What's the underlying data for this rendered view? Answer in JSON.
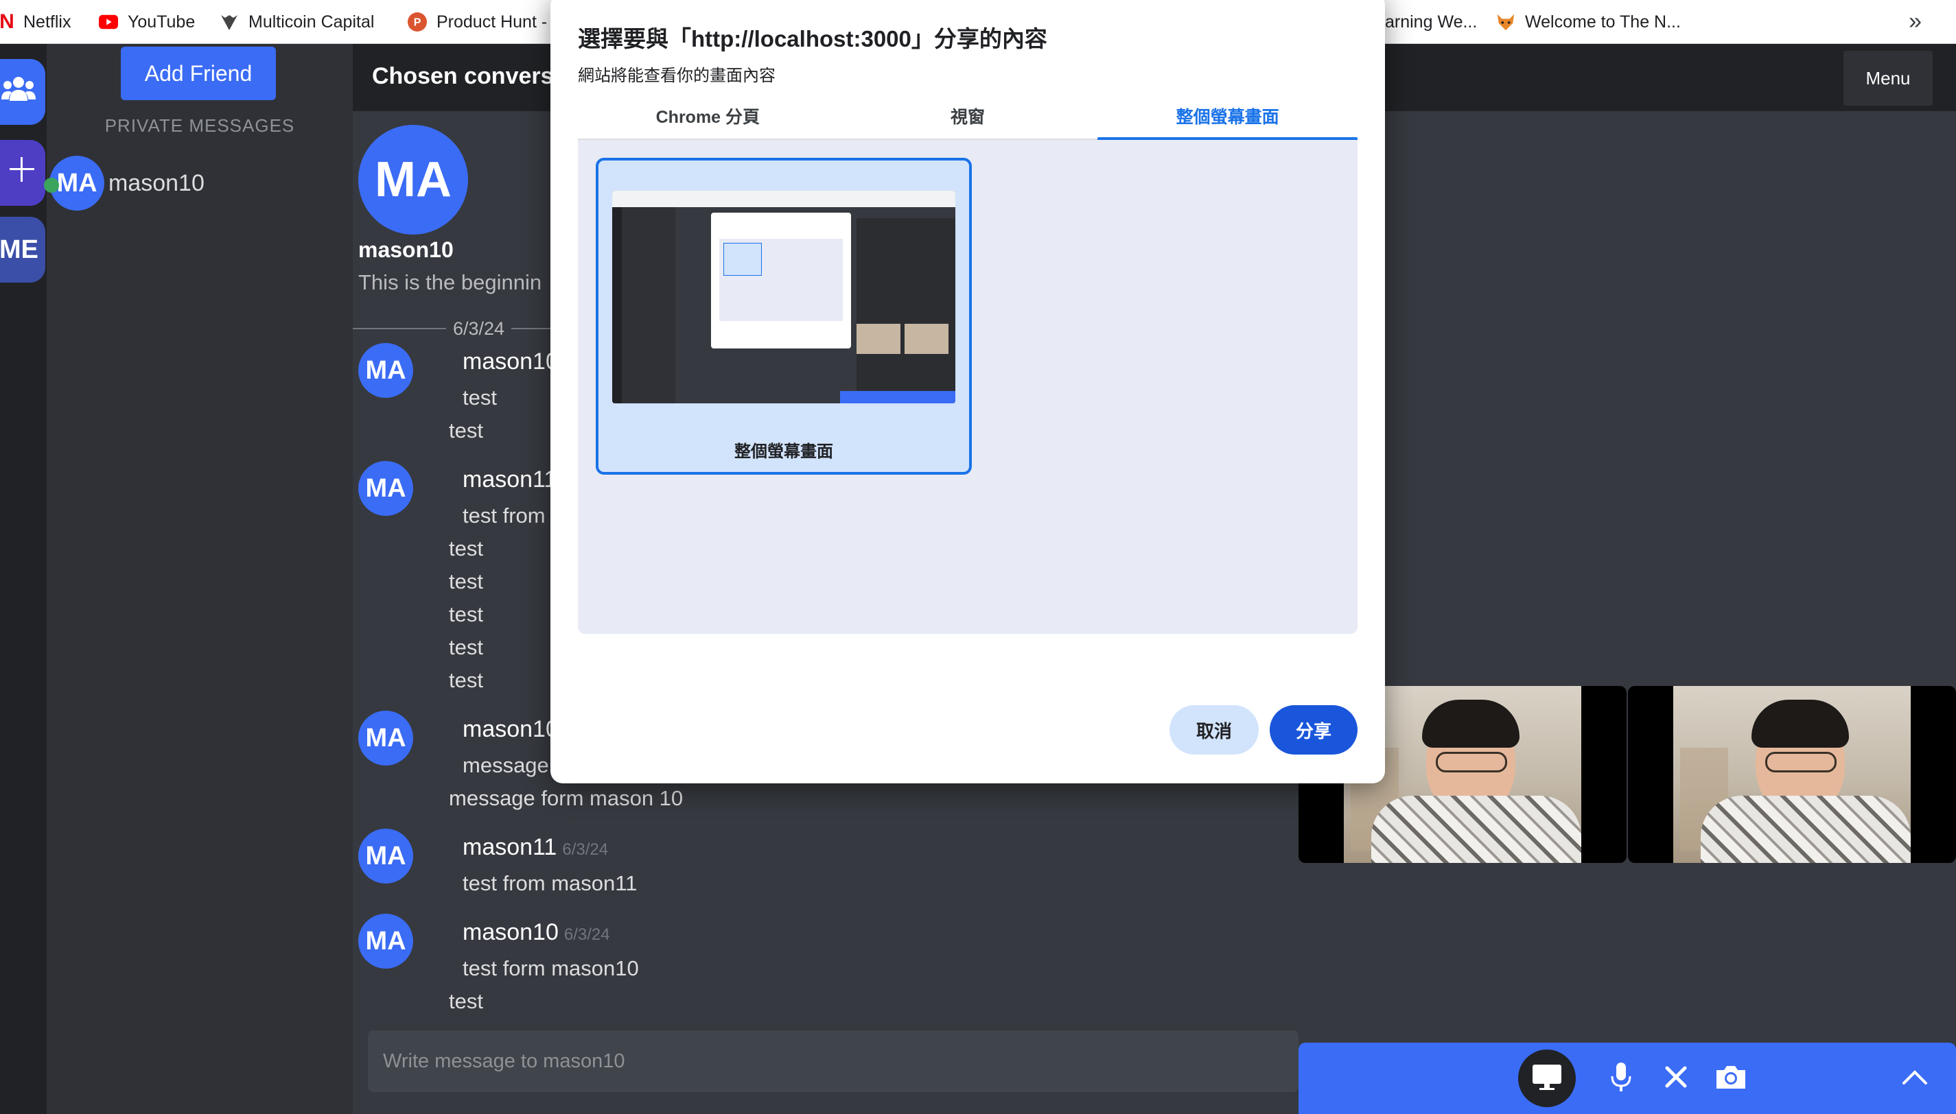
{
  "bookmarks": [
    {
      "label": "Netflix",
      "icon": "netflix-icon",
      "color": "#e50914"
    },
    {
      "label": "YouTube",
      "icon": "youtube-icon",
      "color": "#ff0000"
    },
    {
      "label": "Multicoin Capital",
      "icon": "multicoin-icon",
      "color": "#333333"
    },
    {
      "label": "Product Hunt -",
      "icon": "product-hunt-icon",
      "color": "#da552f"
    },
    {
      "label": "arning We...",
      "icon": "",
      "color": ""
    },
    {
      "label": "Welcome to The N...",
      "icon": "fox-icon",
      "color": "#e8862a"
    }
  ],
  "bookmarks_overflow": "»",
  "rail": {
    "friends_icon": "friends-icon",
    "add_icon": "plus-icon",
    "me_label": "ME"
  },
  "sidebar": {
    "add_friend_label": "Add Friend",
    "section_label": "PRIVATE MESSAGES",
    "items": [
      {
        "initials": "MA",
        "name": "mason10",
        "status": "online"
      }
    ]
  },
  "chat": {
    "title": "Chosen conversa",
    "menu_label": "Menu",
    "intro": {
      "initials": "MA",
      "name": "mason10",
      "text": "This is the beginnin"
    },
    "date_divider": "6/3/24",
    "messages": [
      {
        "initials": "MA",
        "user": "mason10",
        "time": "",
        "lines": [
          "test"
        ],
        "followups": [
          "test"
        ]
      },
      {
        "initials": "MA",
        "user": "mason11",
        "time": "",
        "lines": [
          "test from"
        ],
        "followups": [
          "test",
          "test",
          "test",
          "test",
          "test"
        ]
      },
      {
        "initials": "MA",
        "user": "mason10",
        "time": "",
        "lines": [
          "message"
        ],
        "followups": [
          "message form mason 10"
        ]
      },
      {
        "initials": "MA",
        "user": "mason11",
        "time": "6/3/24",
        "lines": [
          "test from mason11"
        ],
        "followups": []
      },
      {
        "initials": "MA",
        "user": "mason10",
        "time": "6/3/24",
        "lines": [
          "test form mason10"
        ],
        "followups": [
          "test"
        ]
      }
    ],
    "composer_placeholder": "Write message to mason10"
  },
  "call_controls": {
    "screen_share_icon": "monitor-icon",
    "mic_icon": "mic-icon",
    "close_icon": "close-icon",
    "camera_icon": "camera-icon",
    "expand_icon": "chevron-up-icon"
  },
  "share_dialog": {
    "title": "選擇要與「http://localhost:3000」分享的內容",
    "subtitle": "網站將能查看你的畫面內容",
    "tabs": [
      {
        "label": "Chrome 分頁",
        "active": false
      },
      {
        "label": "視窗",
        "active": false
      },
      {
        "label": "整個螢幕畫面",
        "active": true
      }
    ],
    "sources": [
      {
        "label": "整個螢幕畫面",
        "selected": true
      }
    ],
    "cancel_label": "取消",
    "share_label": "分享",
    "accent_color": "#1a73e8"
  }
}
